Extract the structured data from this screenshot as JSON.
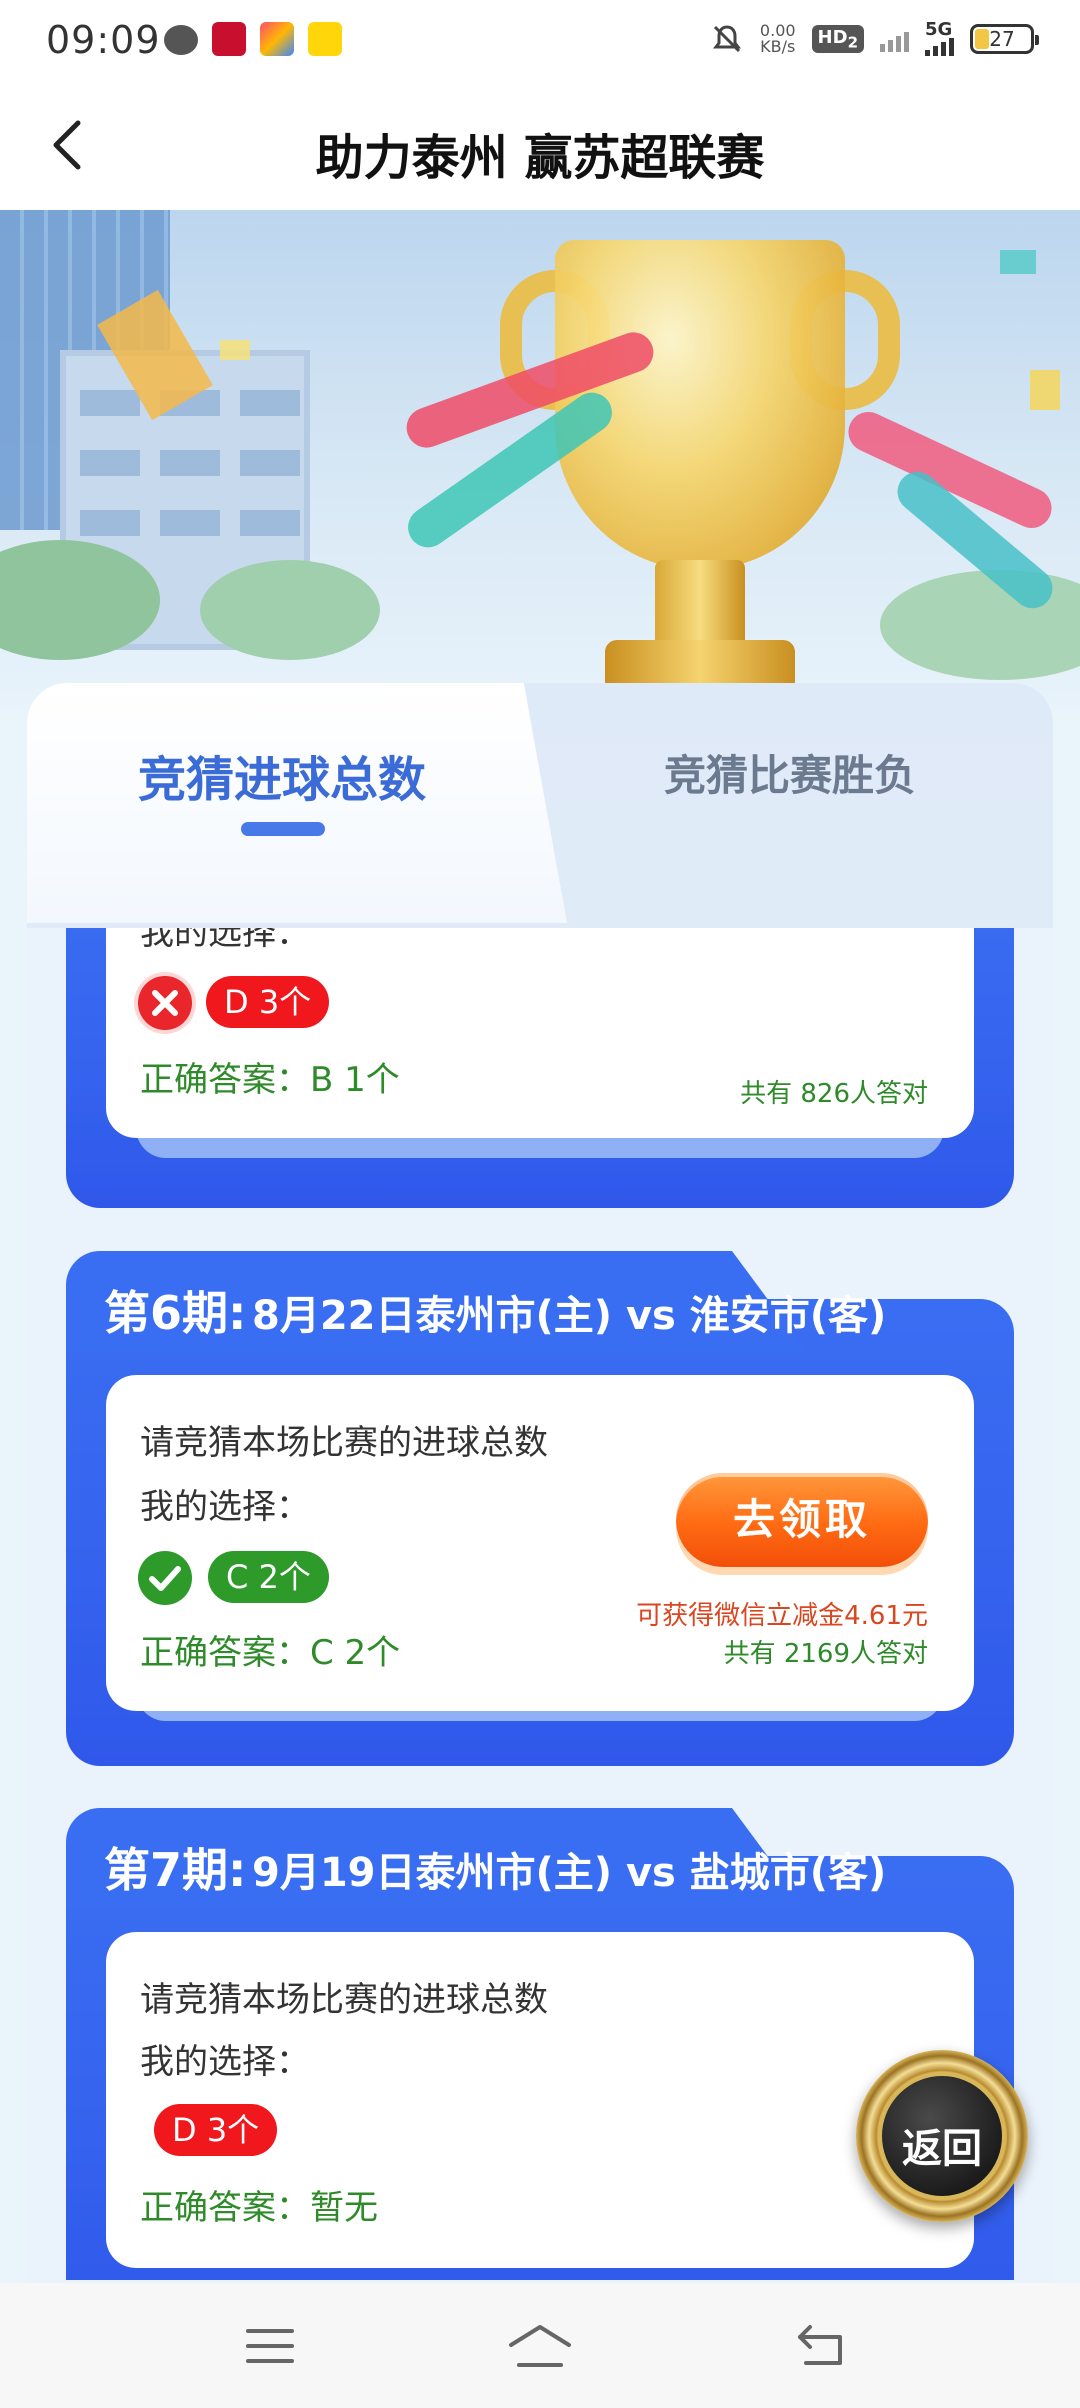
{
  "status_bar": {
    "time": "09:09",
    "net_speed_value": "0.00",
    "net_speed_unit": "KB/s",
    "hd_label": "HD",
    "hd_sub": "2",
    "network": "5G",
    "battery": "27"
  },
  "nav": {
    "title": "助力泰州 赢苏超联赛",
    "back_icon": "chevron-left-icon"
  },
  "tabs": [
    {
      "label": "竞猜进球总数",
      "active": true
    },
    {
      "label": "竞猜比赛胜负",
      "active": false
    }
  ],
  "rounds": [
    {
      "my_choice_label": "我的选择：",
      "result": "wrong",
      "choice": "D 3个",
      "correct_answer": "正确答案：B 1个",
      "correct_count": "共有 826人答对"
    },
    {
      "round": "第6期:",
      "match": "8月22日泰州市(主) vs 淮安市(客)",
      "question": "请竞猜本场比赛的进球总数",
      "my_choice_label": "我的选择：",
      "result": "right",
      "choice": "C 2个",
      "correct_answer": "正确答案：C 2个",
      "claim_button": "去领取",
      "reward_text": "可获得微信立减金4.61元",
      "correct_count": "共有 2169人答对"
    },
    {
      "round": "第7期:",
      "match": "9月19日泰州市(主) vs 盐城市(客)",
      "question": "请竞猜本场比赛的进球总数",
      "my_choice_label": "我的选择：",
      "choice": "D 3个",
      "correct_answer": "正确答案：暂无"
    }
  ],
  "float_button": {
    "label": "返回"
  },
  "system_nav": [
    "menu-icon",
    "home-icon",
    "back-icon"
  ],
  "colors": {
    "primary_blue": "#3a6ef2",
    "tab_active_text": "#3a6bd6",
    "wrong_red": "#f0171d",
    "right_green": "#2d9a2a",
    "answer_green": "#2f8a2a",
    "claim_orange": "#ff6a12"
  }
}
